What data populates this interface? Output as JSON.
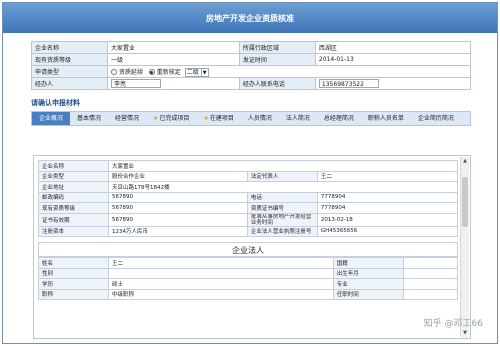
{
  "title": "房地产开发企业资质核准",
  "basic": {
    "company_name_label": "企业名称",
    "company_name": "大家置业",
    "district_label": "所属行政区域",
    "district": "西湖区",
    "current_grade_label": "现有资质等级",
    "current_grade": "一级",
    "issue_time_label": "发证时间",
    "issue_time": "2014-01-13",
    "apply_type_label": "申请类型",
    "opt_renew": "资质延续",
    "opt_reapprove": "重新核定",
    "grade_select": "二级",
    "handler_label": "经办人",
    "handler": "李亮",
    "handler_phone_label": "经办人联系电话",
    "handler_phone": "13569873522"
  },
  "section_title": "请确认申报材料",
  "tabs": [
    "企业概况",
    "基本情况",
    "经营情况",
    "已完成项目",
    "在建项目",
    "人员情况",
    "法人简况",
    "总经理简况",
    "职称人员名单",
    "企业简历简况"
  ],
  "detail": [
    [
      "企业名称",
      "大家置业",
      "",
      ""
    ],
    [
      "企业类型",
      "股份合作企业",
      "法定代表人",
      "王二"
    ],
    [
      "企业地址",
      "天目山路178号1842楼",
      "",
      ""
    ],
    [
      "邮政编码",
      "567890",
      "电话",
      "7778904"
    ],
    [
      "现有资质等级",
      "567890",
      "资质证书编号",
      "7778904"
    ],
    [
      "证书有效期",
      "567890",
      "批准从事房地产开发经营业务时间",
      "2013-02-18"
    ],
    [
      "注册资本",
      "1234万人民币",
      "企业法人营业执照注册号",
      "GH45365656"
    ]
  ],
  "legal_title": "企业法人",
  "legal": [
    [
      "姓名",
      "王二",
      "国籍",
      ""
    ],
    [
      "性别",
      "",
      "出生年月",
      ""
    ],
    [
      "学历",
      "硕士",
      "专业",
      ""
    ],
    [
      "职称",
      "中级职称",
      "任职时间",
      ""
    ]
  ],
  "watermark": "知乎 @邓工66"
}
